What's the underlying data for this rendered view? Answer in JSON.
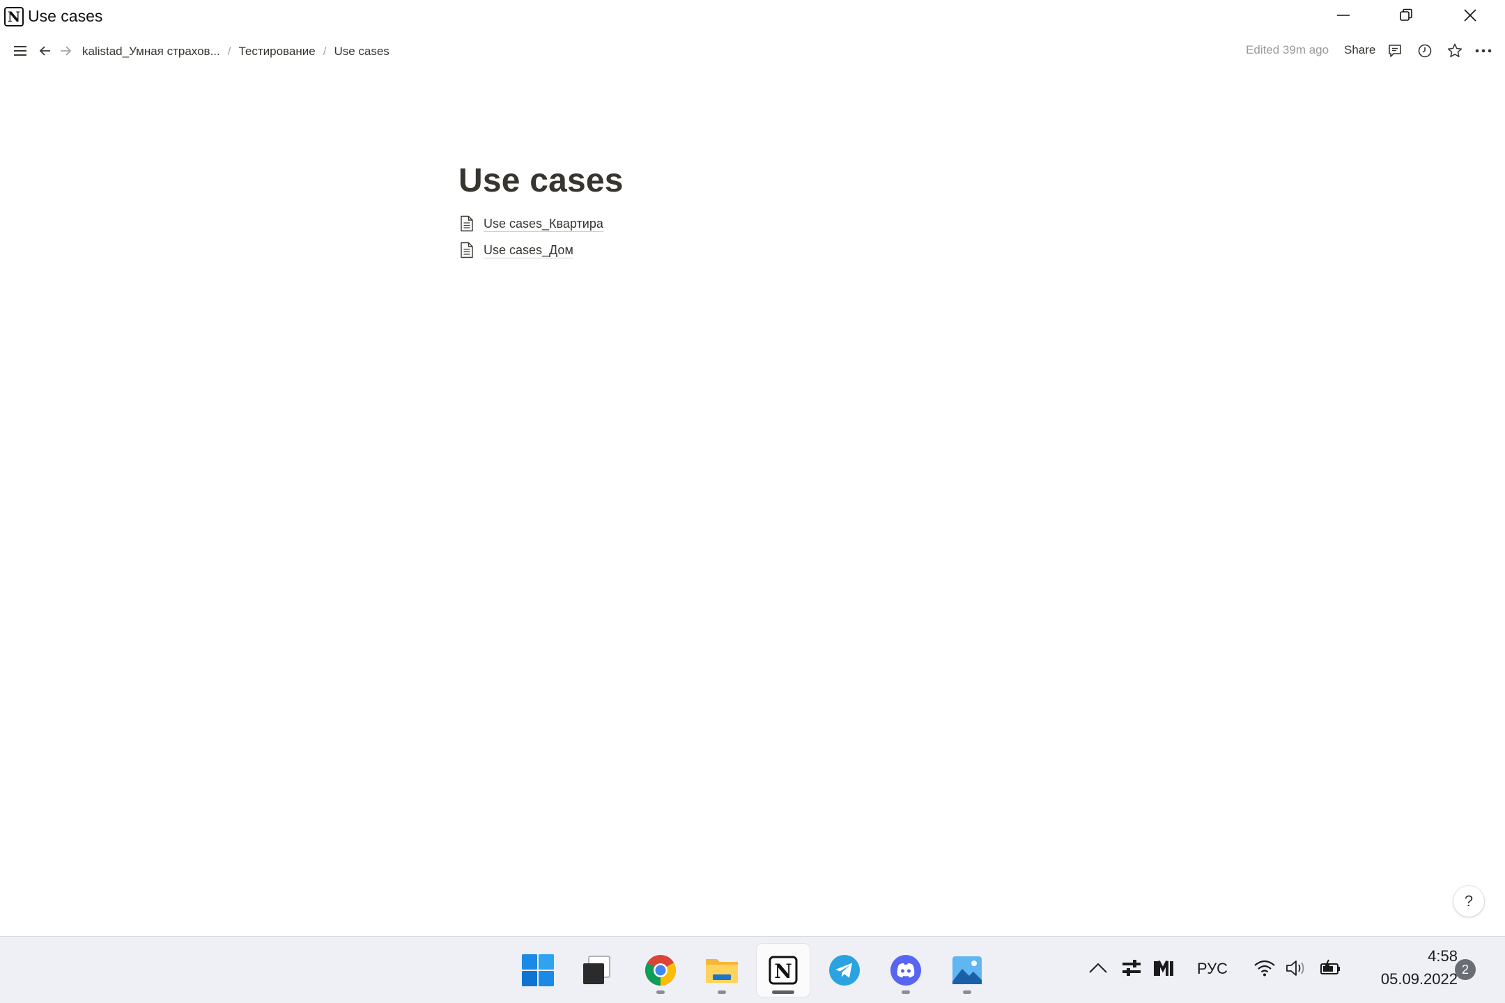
{
  "window": {
    "title": "Use cases",
    "app_icon": "notion-icon"
  },
  "topbar": {
    "breadcrumb": [
      "kalistad_Умная страхов...",
      "Тестирование",
      "Use cases"
    ],
    "separator": "/",
    "edited": "Edited 39m ago",
    "share_label": "Share"
  },
  "page": {
    "title": "Use cases",
    "subpages": [
      "Use cases_Квартира",
      "Use cases_Дом"
    ]
  },
  "help_label": "?",
  "taskbar": {
    "apps": [
      "windows-start-icon",
      "terminal-icon",
      "chrome-icon",
      "file-explorer-icon",
      "notion-icon",
      "telegram-icon",
      "discord-icon",
      "photos-icon"
    ],
    "active_app": "notion-icon",
    "language": "РУС",
    "time": "4:58",
    "date": "05.09.2022",
    "notification_count": "2"
  }
}
